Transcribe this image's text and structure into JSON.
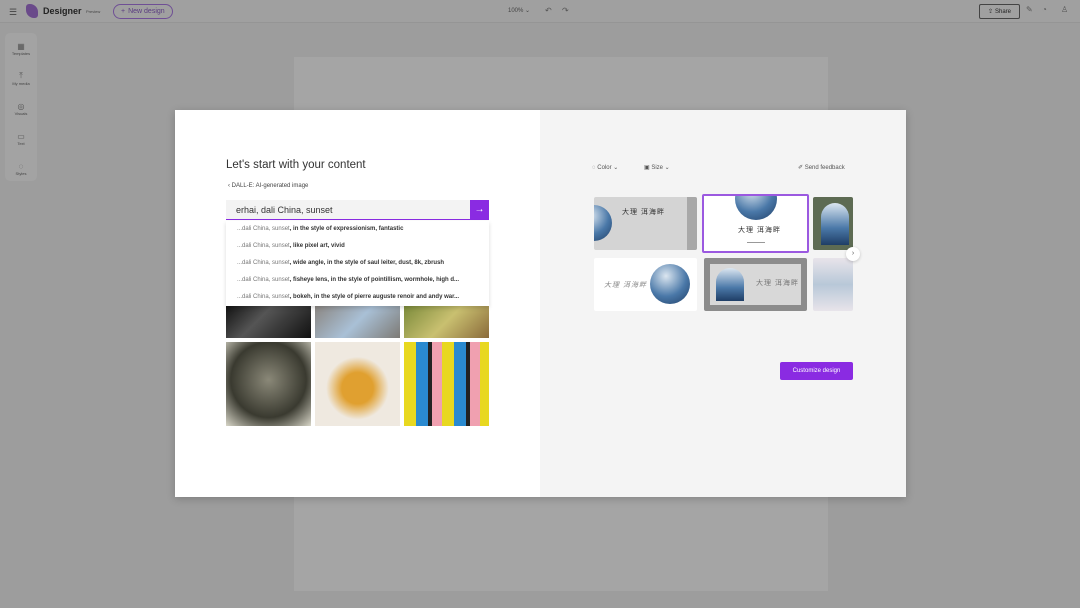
{
  "topbar": {
    "app_name": "Designer",
    "badge": "Preview",
    "new_design": "New design",
    "zoom": "100%",
    "share": "Share"
  },
  "sidebar": {
    "items": [
      {
        "label": "Templates",
        "icon": "grid-icon"
      },
      {
        "label": "My media",
        "icon": "upload-icon"
      },
      {
        "label": "Visuals",
        "icon": "shapes-icon"
      },
      {
        "label": "Text",
        "icon": "text-icon"
      },
      {
        "label": "Styles",
        "icon": "palette-icon"
      }
    ]
  },
  "modal": {
    "title": "Let's start with your content",
    "back_label": "DALL-E: AI-generated image",
    "search_value": "erhai, dali China, sunset",
    "suggestions": [
      {
        "prefix": "...dali China, sunset",
        "suffix": ", in the style of expressionism, fantastic"
      },
      {
        "prefix": "...dali China, sunset",
        "suffix": ", like pixel art, vivid"
      },
      {
        "prefix": "...dali China, sunset",
        "suffix": ", wide angle, in the style of saul leiter, dust, 8k, zbrush"
      },
      {
        "prefix": "...dali China, sunset",
        "suffix": ", fisheye lens, in the style of pointillism, wormhole, high d..."
      },
      {
        "prefix": "...dali China, sunset",
        "suffix": ", bokeh, in the style of pierre auguste renoir and andy war..."
      }
    ],
    "color_label": "Color",
    "size_label": "Size",
    "feedback_label": "Send feedback",
    "template_text": "大理 洱海畔",
    "customize": "Customize design"
  }
}
